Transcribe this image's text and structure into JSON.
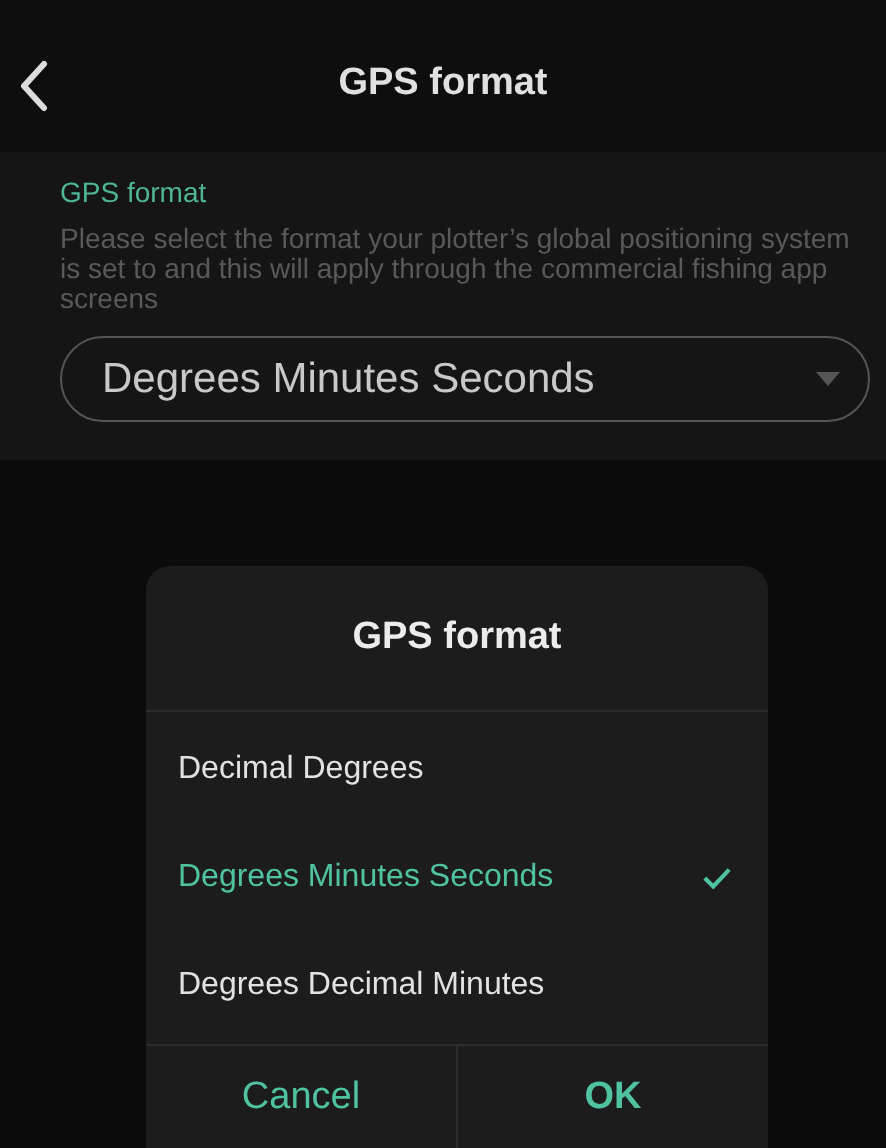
{
  "header": {
    "title": "GPS format"
  },
  "setting": {
    "label": "GPS format",
    "description": "Please select the format your plotter’s global positioning system is set to and this will apply through the commercial fishing app screens",
    "value": "Degrees Minutes Seconds"
  },
  "dialog": {
    "title": "GPS format",
    "options": [
      {
        "label": "Decimal Degrees",
        "selected": false
      },
      {
        "label": "Degrees Minutes Seconds",
        "selected": true
      },
      {
        "label": "Degrees Decimal Minutes",
        "selected": false
      }
    ],
    "buttons": [
      {
        "label": "Cancel",
        "kind": "cancel"
      },
      {
        "label": "OK",
        "kind": "confirm"
      }
    ]
  }
}
